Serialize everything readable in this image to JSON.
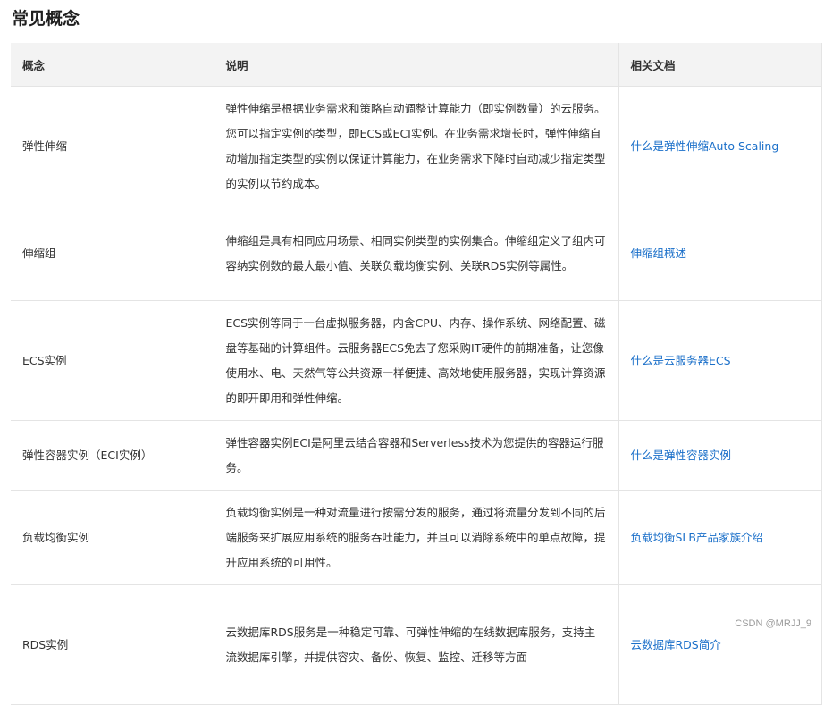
{
  "page": {
    "title": "常见概念"
  },
  "table": {
    "headers": [
      "概念",
      "说明",
      "相关文档"
    ],
    "rows": [
      {
        "concept": "弹性伸缩",
        "desc": "弹性伸缩是根据业务需求和策略自动调整计算能力（即实例数量）的云服务。您可以指定实例的类型，即ECS或ECI实例。在业务需求增长时，弹性伸缩自动增加指定类型的实例以保证计算能力，在业务需求下降时自动减少指定类型的实例以节约成本。",
        "doc": "什么是弹性伸缩Auto Scaling"
      },
      {
        "concept": "伸缩组",
        "desc": "伸缩组是具有相同应用场景、相同实例类型的实例集合。伸缩组定义了组内可容纳实例数的最大最小值、关联负载均衡实例、关联RDS实例等属性。",
        "doc": "伸缩组概述"
      },
      {
        "concept": "ECS实例",
        "desc": "ECS实例等同于一台虚拟服务器，内含CPU、内存、操作系统、网络配置、磁盘等基础的计算组件。云服务器ECS免去了您采购IT硬件的前期准备，让您像使用水、电、天然气等公共资源一样便捷、高效地使用服务器，实现计算资源的即开即用和弹性伸缩。",
        "doc": "什么是云服务器ECS"
      },
      {
        "concept": "弹性容器实例（ECI实例）",
        "desc": "弹性容器实例ECI是阿里云结合容器和Serverless技术为您提供的容器运行服务。",
        "doc": "什么是弹性容器实例"
      },
      {
        "concept": "负载均衡实例",
        "desc": "负载均衡实例是一种对流量进行按需分发的服务，通过将流量分发到不同的后端服务来扩展应用系统的服务吞吐能力，并且可以消除系统中的单点故障，提升应用系统的可用性。",
        "doc": "负载均衡SLB产品家族介绍"
      },
      {
        "concept": "RDS实例",
        "desc": "云数据库RDS服务是一种稳定可靠、可弹性伸缩的在线数据库服务，支持主流数据库引擎，并提供容灾、备份、恢复、监控、迁移等方面",
        "doc": "云数据库RDS简介"
      }
    ]
  },
  "watermark": "CSDN @MRJJ_9"
}
